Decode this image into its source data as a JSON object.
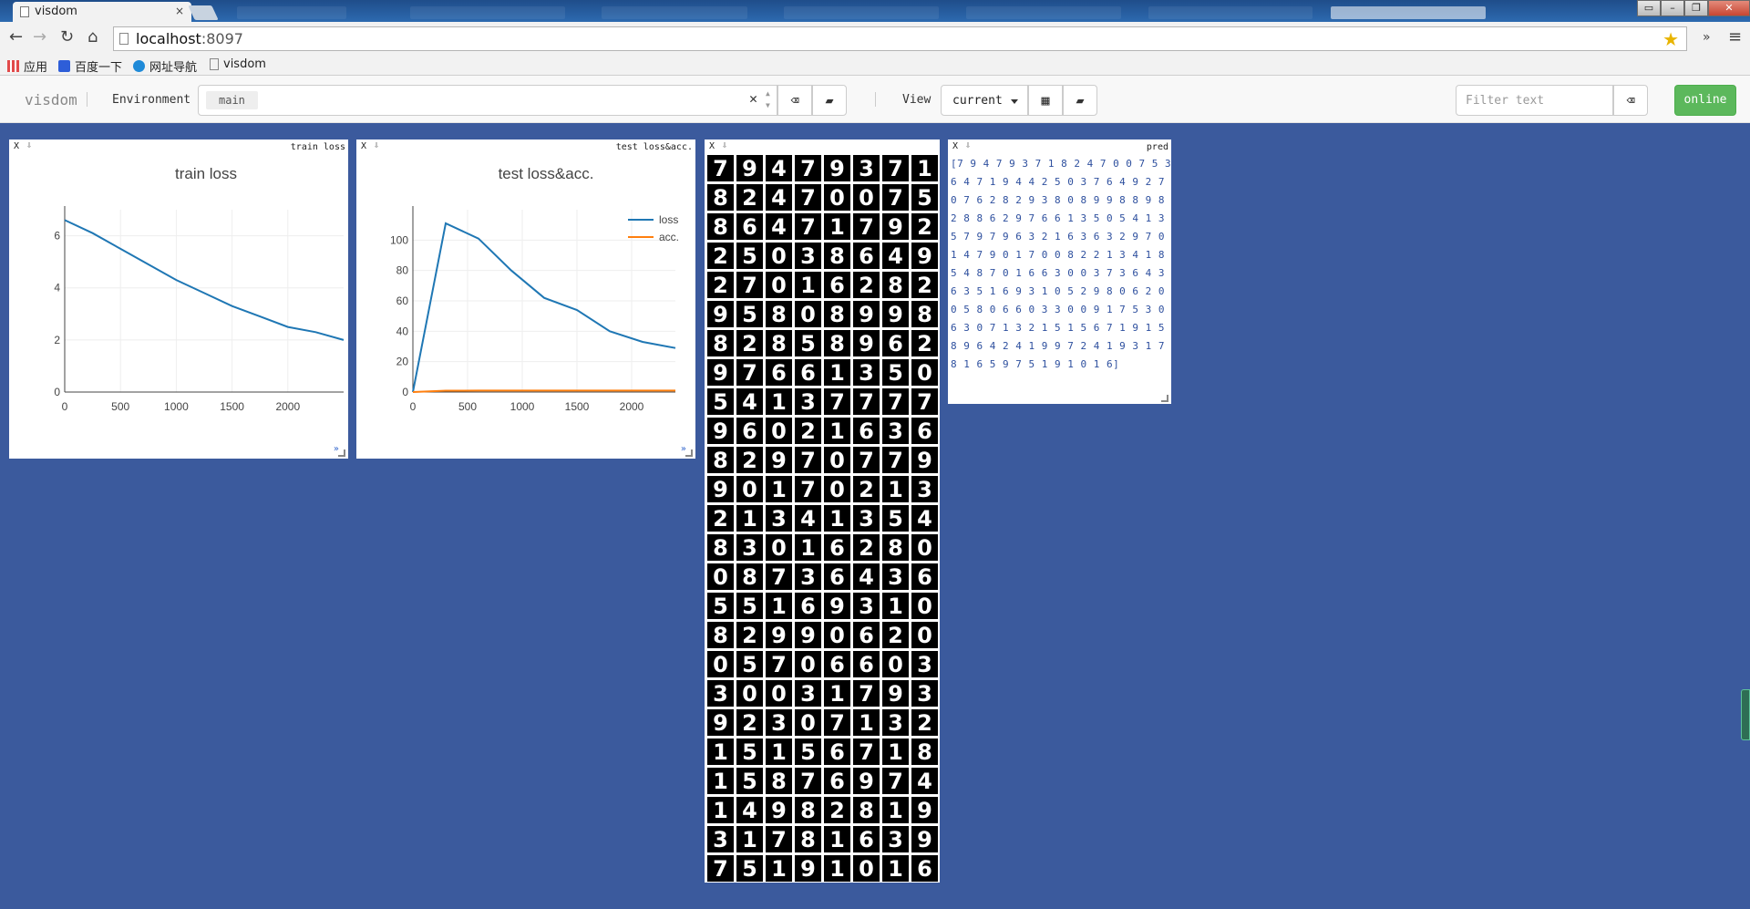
{
  "browser": {
    "tab_title": "visdom",
    "tab_close": "×",
    "url_host": "localhost",
    "url_port": ":8097",
    "bookmarks": [
      {
        "label": "应用",
        "icon": "apps-grid-icon",
        "color": "#e24a4a"
      },
      {
        "label": "百度一下",
        "icon": "baidu-paw-icon",
        "color": "#2e5ed8"
      },
      {
        "label": "网址导航",
        "icon": "ie-globe-icon",
        "color": "#1f8ad8"
      },
      {
        "label": "visdom",
        "icon": "page-icon",
        "color": "#888888"
      }
    ],
    "nav": {
      "back": "←",
      "forward": "→",
      "reload": "↻",
      "home": "⌂",
      "star": "★",
      "more": "»",
      "menu": "≡"
    }
  },
  "visdom": {
    "brand": "visdom",
    "environment_label": "Environment",
    "environment_value": "main",
    "view_label": "View",
    "view_value": "current",
    "filter_placeholder": "Filter text",
    "online_label": "online",
    "colors": {
      "navbar": "#f8f8f8",
      "background": "#3b5a9d",
      "online": "#5cb85c"
    }
  },
  "panes": {
    "train": {
      "close": "X",
      "title": "train loss",
      "mode": "»"
    },
    "test": {
      "close": "X",
      "title": "test loss&acc.",
      "mode": "»"
    },
    "images": {
      "close": "X"
    },
    "pred": {
      "close": "X",
      "title": "pred",
      "text": "[7 9 4 7 9 3 7 1 8 2 4 7 0 0 7 5 3 6 4 7 1 9 4 4 2 5 0 3 7 6 4 9 2 7 0 7 6 2 8 2 9 3 8 0 8 9 9 8 8 9 8 2 8 8 6 2 9 7 6 6 1 3 5 0 5 4 1 3 5 7 9 7 9 6 3 2 1 6 3 6 3 2 9 7 0 1 4 7 9 0 1 7 0 0 8 2 2 1 3 4 1 8 5 4 8 7 0 1 6 6 3 0 0 3 7 3 6 4 3 6 3 5 1 6 9 3 1 0 5 2 9 8 0 6 2 0 0 5 8 0 6 6 0 3 3 0 0 9 1 7 5 3 0 6 3 0 7 1 3 2 1 5 1 5 6 7 1 9 1 5 8 9 6 4 2 4 1 9 9 7 2 4 1 9 3 1 7 8 1 6 5 9 7 5 1 9 1 0 1 6]"
    }
  },
  "mnist_digits": [
    "7",
    "9",
    "4",
    "7",
    "9",
    "3",
    "7",
    "1",
    "8",
    "2",
    "4",
    "7",
    "0",
    "0",
    "7",
    "5",
    "8",
    "6",
    "4",
    "7",
    "1",
    "7",
    "9",
    "2",
    "2",
    "5",
    "0",
    "3",
    "8",
    "6",
    "4",
    "9",
    "2",
    "7",
    "0",
    "1",
    "6",
    "2",
    "8",
    "2",
    "9",
    "5",
    "8",
    "0",
    "8",
    "9",
    "9",
    "8",
    "8",
    "2",
    "8",
    "5",
    "8",
    "9",
    "6",
    "2",
    "9",
    "7",
    "6",
    "6",
    "1",
    "3",
    "5",
    "0",
    "5",
    "4",
    "1",
    "3",
    "7",
    "7",
    "7",
    "7",
    "9",
    "6",
    "0",
    "2",
    "1",
    "6",
    "3",
    "6",
    "8",
    "2",
    "9",
    "7",
    "0",
    "7",
    "7",
    "9",
    "9",
    "0",
    "1",
    "7",
    "0",
    "2",
    "1",
    "3",
    "2",
    "1",
    "3",
    "4",
    "1",
    "3",
    "5",
    "4",
    "8",
    "3",
    "0",
    "1",
    "6",
    "2",
    "8",
    "0",
    "0",
    "8",
    "7",
    "3",
    "6",
    "4",
    "3",
    "6",
    "5",
    "5",
    "1",
    "6",
    "9",
    "3",
    "1",
    "0",
    "8",
    "2",
    "9",
    "9",
    "0",
    "6",
    "2",
    "0",
    "0",
    "5",
    "7",
    "0",
    "6",
    "6",
    "0",
    "3",
    "3",
    "0",
    "0",
    "3",
    "1",
    "7",
    "9",
    "3",
    "9",
    "2",
    "3",
    "0",
    "7",
    "1",
    "3",
    "2",
    "1",
    "5",
    "1",
    "5",
    "6",
    "7",
    "1",
    "8",
    "1",
    "5",
    "8",
    "7",
    "6",
    "9",
    "7",
    "4",
    "1",
    "4",
    "9",
    "8",
    "2",
    "8",
    "1",
    "9",
    "3",
    "1",
    "7",
    "8",
    "1",
    "6",
    "3",
    "9",
    "7",
    "5",
    "1",
    "9",
    "1",
    "0",
    "1",
    "6"
  ],
  "chart_data": [
    {
      "type": "line",
      "title": "train loss",
      "xlim": [
        0,
        2500
      ],
      "ylim": [
        0,
        7
      ],
      "x_ticks": [
        0,
        500,
        1000,
        1500,
        2000
      ],
      "y_ticks": [
        0,
        2,
        4,
        6
      ],
      "grid": true,
      "series": [
        {
          "color": "#1f77b4",
          "x": [
            0,
            250,
            500,
            750,
            1000,
            1250,
            1500,
            1750,
            2000,
            2250,
            2500
          ],
          "y": [
            6.6,
            6.1,
            5.5,
            4.9,
            4.3,
            3.8,
            3.3,
            2.9,
            2.5,
            2.3,
            2.0
          ]
        }
      ]
    },
    {
      "type": "line",
      "title": "test loss&acc.",
      "xlim": [
        0,
        2400
      ],
      "ylim": [
        0,
        120
      ],
      "x_ticks": [
        0,
        500,
        1000,
        1500,
        2000
      ],
      "y_ticks": [
        0,
        20,
        40,
        60,
        80,
        100
      ],
      "grid": true,
      "legend": "top-right",
      "series": [
        {
          "name": "loss",
          "color": "#1f77b4",
          "x": [
            0,
            300,
            600,
            900,
            1200,
            1500,
            1800,
            2100,
            2400
          ],
          "y": [
            0,
            111,
            101,
            80,
            62,
            54,
            40,
            33,
            29
          ]
        },
        {
          "name": "acc.",
          "color": "#ff7f0e",
          "x": [
            0,
            300,
            600,
            900,
            1200,
            1500,
            1800,
            2100,
            2400
          ],
          "y": [
            0,
            0.9,
            0.95,
            0.96,
            0.97,
            0.97,
            0.98,
            0.98,
            0.98
          ]
        }
      ]
    }
  ]
}
